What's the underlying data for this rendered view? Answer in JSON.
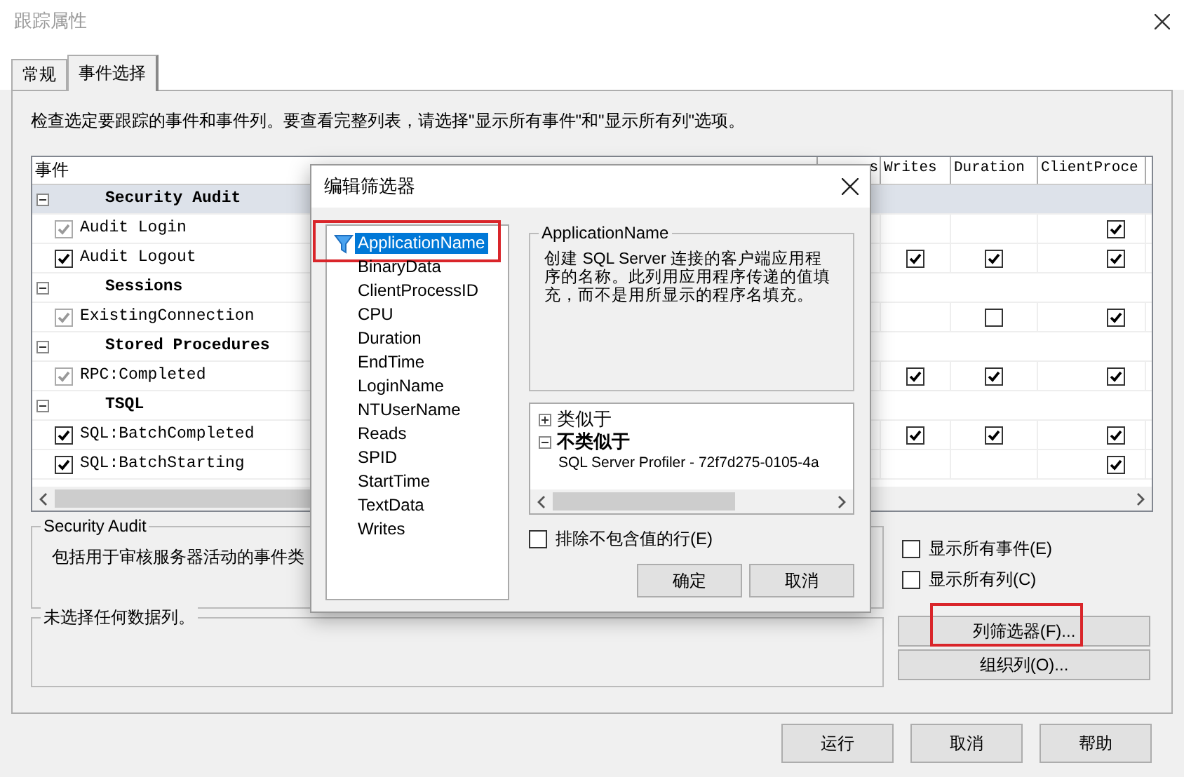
{
  "window": {
    "title": "跟踪属性"
  },
  "tabs": [
    {
      "label": "常规",
      "selected": false
    },
    {
      "label": "事件选择",
      "selected": true
    }
  ],
  "instruction": "检查选定要跟踪的事件和事件列。要查看完整列表，请选择\"显示所有事件\"和\"显示所有列\"选项。",
  "events_grid": {
    "columns": [
      {
        "label": "事件"
      },
      {
        "label": "s"
      },
      {
        "label": "Writes"
      },
      {
        "label": "Duration"
      },
      {
        "label": "ClientProce"
      }
    ],
    "rows": [
      {
        "kind": "group",
        "label": "Security Audit",
        "expanded": true,
        "selected": true
      },
      {
        "kind": "event",
        "label": "Audit Login",
        "checked": true,
        "disabled": true,
        "cells": [
          {
            "kind": "empty"
          },
          {
            "kind": "empty"
          },
          {
            "kind": "empty"
          },
          {
            "kind": "check",
            "checked": true
          }
        ]
      },
      {
        "kind": "event",
        "label": "Audit Logout",
        "checked": true,
        "disabled": false,
        "cells": [
          {
            "kind": "empty"
          },
          {
            "kind": "check",
            "checked": true
          },
          {
            "kind": "check",
            "checked": true
          },
          {
            "kind": "check",
            "checked": true
          }
        ]
      },
      {
        "kind": "group",
        "label": "Sessions",
        "expanded": true,
        "selected": false
      },
      {
        "kind": "event",
        "label": "ExistingConnection",
        "checked": true,
        "disabled": true,
        "cells": [
          {
            "kind": "empty"
          },
          {
            "kind": "empty"
          },
          {
            "kind": "check",
            "checked": false
          },
          {
            "kind": "check",
            "checked": true
          }
        ]
      },
      {
        "kind": "group",
        "label": "Stored Procedures",
        "expanded": true,
        "selected": false
      },
      {
        "kind": "event",
        "label": "RPC:Completed",
        "checked": true,
        "disabled": true,
        "cells": [
          {
            "kind": "empty"
          },
          {
            "kind": "check",
            "checked": true
          },
          {
            "kind": "check",
            "checked": true
          },
          {
            "kind": "check",
            "checked": true
          }
        ]
      },
      {
        "kind": "group",
        "label": "TSQL",
        "expanded": true,
        "selected": false
      },
      {
        "kind": "event",
        "label": "SQL:BatchCompleted",
        "checked": true,
        "disabled": false,
        "cells": [
          {
            "kind": "empty"
          },
          {
            "kind": "check",
            "checked": true
          },
          {
            "kind": "check",
            "checked": true
          },
          {
            "kind": "check",
            "checked": true
          }
        ]
      },
      {
        "kind": "event",
        "label": "SQL:BatchStarting",
        "checked": true,
        "disabled": false,
        "cells": [
          {
            "kind": "empty"
          },
          {
            "kind": "empty"
          },
          {
            "kind": "empty"
          },
          {
            "kind": "check",
            "checked": true
          }
        ]
      }
    ]
  },
  "event_description": {
    "title": "Security Audit",
    "text": "包括用于审核服务器活动的事件类"
  },
  "column_description": {
    "title": "未选择任何数据列。"
  },
  "options": [
    {
      "label": "显示所有事件(E)",
      "checked": false
    },
    {
      "label": "显示所有列(C)",
      "checked": false
    }
  ],
  "side_buttons": [
    {
      "label": "列筛选器(F)...",
      "highlighted": true
    },
    {
      "label": "组织列(O)...",
      "highlighted": false
    }
  ],
  "footer_buttons": [
    "运行",
    "取消",
    "帮助"
  ],
  "filter_dialog": {
    "title": "编辑筛选器",
    "columns": [
      {
        "label": "ApplicationName",
        "selected": true,
        "filtered": true,
        "highlighted": true
      },
      {
        "label": "BinaryData",
        "selected": false,
        "filtered": false,
        "highlighted": false
      },
      {
        "label": "ClientProcessID",
        "selected": false,
        "filtered": false,
        "highlighted": false
      },
      {
        "label": "CPU",
        "selected": false,
        "filtered": false,
        "highlighted": false
      },
      {
        "label": "Duration",
        "selected": false,
        "filtered": false,
        "highlighted": false
      },
      {
        "label": "EndTime",
        "selected": false,
        "filtered": false,
        "highlighted": false
      },
      {
        "label": "LoginName",
        "selected": false,
        "filtered": false,
        "highlighted": false
      },
      {
        "label": "NTUserName",
        "selected": false,
        "filtered": false,
        "highlighted": false
      },
      {
        "label": "Reads",
        "selected": false,
        "filtered": false,
        "highlighted": false
      },
      {
        "label": "SPID",
        "selected": false,
        "filtered": false,
        "highlighted": false
      },
      {
        "label": "StartTime",
        "selected": false,
        "filtered": false,
        "highlighted": false
      },
      {
        "label": "TextData",
        "selected": false,
        "filtered": false,
        "highlighted": false
      },
      {
        "label": "Writes",
        "selected": false,
        "filtered": false,
        "highlighted": false
      }
    ],
    "description": {
      "title": "ApplicationName",
      "text": "创建 SQL Server 连接的客户端应用程序的名称。此列用应用程序传递的值填充，而不是用所显示的程序名填充。"
    },
    "conditions": [
      {
        "label": "类似于",
        "expanded": false,
        "has_values": false
      },
      {
        "label": "不类似于",
        "expanded": true,
        "has_values": true,
        "children": [
          {
            "label": "SQL Server Profiler - 72f7d275-0105-4a"
          }
        ]
      }
    ],
    "exclude_empty": {
      "label": "排除不包含值的行(E)",
      "checked": false
    },
    "buttons": [
      "确定",
      "取消"
    ]
  }
}
